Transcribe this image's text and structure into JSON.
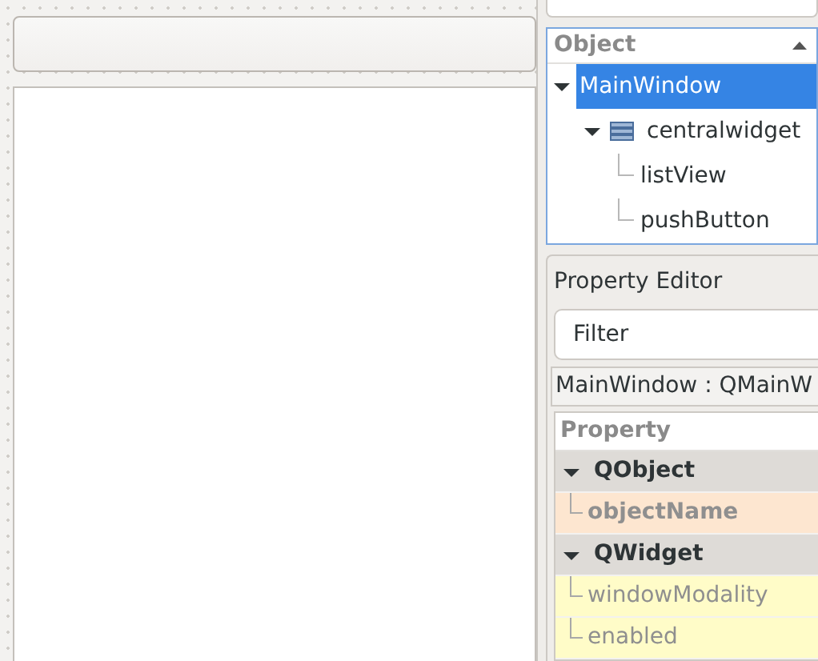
{
  "form": {
    "widgets": [
      {
        "kind": "button"
      },
      {
        "kind": "list"
      }
    ]
  },
  "object_inspector": {
    "header": "Object",
    "tree": [
      {
        "label": "MainWindow",
        "selected": true,
        "expanded": true,
        "children": [
          {
            "label": "centralwidget",
            "selected": false,
            "expanded": true,
            "children": [
              {
                "label": "listView",
                "selected": false
              },
              {
                "label": "pushButton",
                "selected": false
              }
            ]
          }
        ]
      }
    ]
  },
  "property_editor": {
    "title": "Property Editor",
    "filter": {
      "placeholder": "Filter"
    },
    "class_label": "MainWindow : QMainW",
    "header": "Property",
    "rows": [
      {
        "kind": "group",
        "label": "QObject",
        "expanded": true
      },
      {
        "kind": "property",
        "label": "objectName",
        "modified": true,
        "color": "#fde6d0"
      },
      {
        "kind": "group",
        "label": "QWidget",
        "expanded": true
      },
      {
        "kind": "property",
        "label": "windowModality",
        "modified": false,
        "color": "#fffcc8"
      },
      {
        "kind": "property",
        "label": "enabled",
        "modified": false,
        "color": "#fffcc8"
      }
    ]
  }
}
